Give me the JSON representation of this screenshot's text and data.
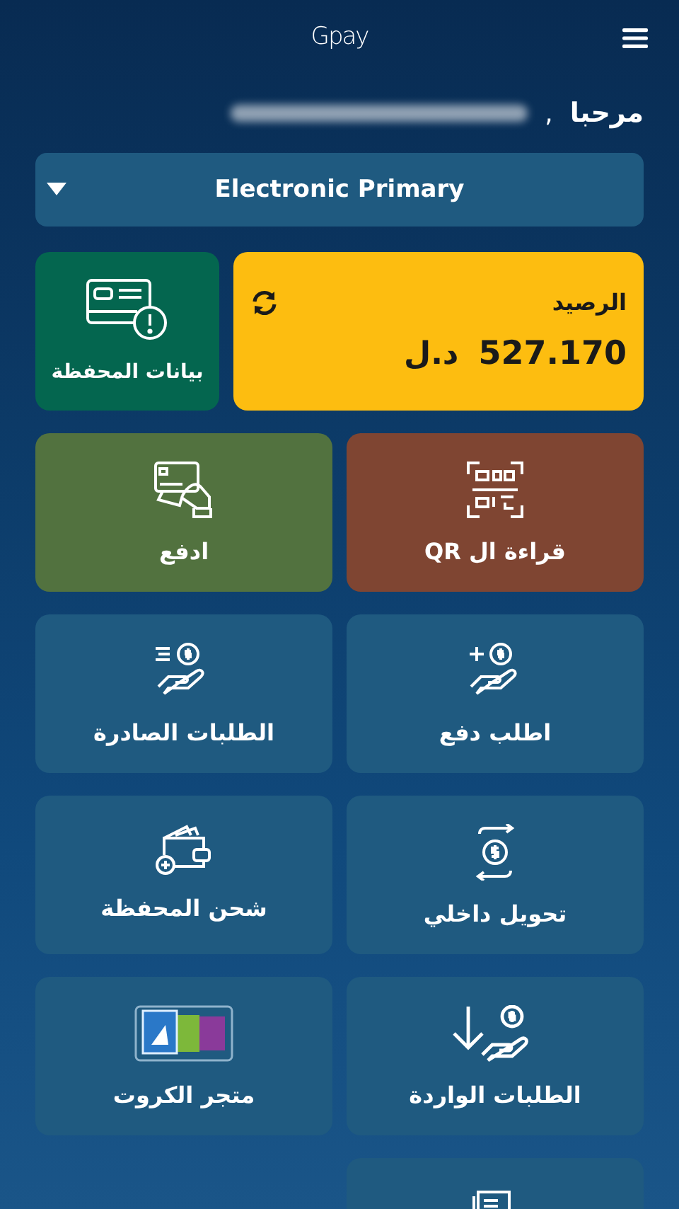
{
  "header": {
    "logo": "Gpay"
  },
  "greeting": {
    "label": "مرحبا",
    "separator": ","
  },
  "account_selector": {
    "value": "Electronic Primary"
  },
  "balance": {
    "label": "الرصيد",
    "amount": "527.170",
    "currency": "د.ل"
  },
  "wallet_info": {
    "label": "بيانات المحفظة"
  },
  "tiles": [
    {
      "label": "قراءة ال QR",
      "color": "#7f4532"
    },
    {
      "label": "ادفع",
      "color": "#52723f"
    },
    {
      "label": "اطلب دفع",
      "color": "#1f5a80"
    },
    {
      "label": "الطلبات الصادرة",
      "color": "#1f5a80"
    },
    {
      "label": "تحويل داخلي",
      "color": "#1f5a80"
    },
    {
      "label": "شحن المحفظة",
      "color": "#1f5a80"
    },
    {
      "label": "الطلبات الواردة",
      "color": "#1f5a80"
    },
    {
      "label": "متجر الكروت",
      "color": "#1f5a80"
    },
    {
      "color": "#1f5a80"
    }
  ]
}
